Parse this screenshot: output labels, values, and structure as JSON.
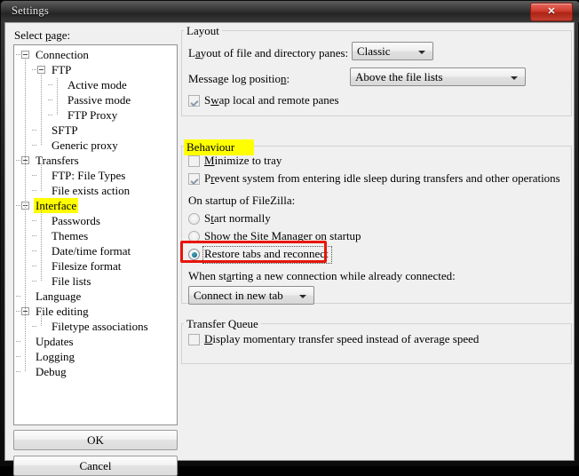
{
  "window": {
    "title": "Settings",
    "close_label": "✕"
  },
  "sidebar": {
    "label": "Select page:",
    "tree": [
      {
        "label": "Connection",
        "depth": 0,
        "expander": true,
        "highlight": false
      },
      {
        "label": "FTP",
        "depth": 1,
        "expander": true,
        "highlight": false
      },
      {
        "label": "Active mode",
        "depth": 2,
        "expander": false,
        "highlight": false
      },
      {
        "label": "Passive mode",
        "depth": 2,
        "expander": false,
        "highlight": false
      },
      {
        "label": "FTP Proxy",
        "depth": 2,
        "expander": false,
        "highlight": false
      },
      {
        "label": "SFTP",
        "depth": 1,
        "expander": false,
        "highlight": false
      },
      {
        "label": "Generic proxy",
        "depth": 1,
        "expander": false,
        "highlight": false
      },
      {
        "label": "Transfers",
        "depth": 0,
        "expander": true,
        "highlight": false
      },
      {
        "label": "FTP: File Types",
        "depth": 1,
        "expander": false,
        "highlight": false
      },
      {
        "label": "File exists action",
        "depth": 1,
        "expander": false,
        "highlight": false
      },
      {
        "label": "Interface",
        "depth": 0,
        "expander": true,
        "highlight": true
      },
      {
        "label": "Passwords",
        "depth": 1,
        "expander": false,
        "highlight": false
      },
      {
        "label": "Themes",
        "depth": 1,
        "expander": false,
        "highlight": false
      },
      {
        "label": "Date/time format",
        "depth": 1,
        "expander": false,
        "highlight": false
      },
      {
        "label": "Filesize format",
        "depth": 1,
        "expander": false,
        "highlight": false
      },
      {
        "label": "File lists",
        "depth": 1,
        "expander": false,
        "highlight": false
      },
      {
        "label": "Language",
        "depth": 0,
        "expander": false,
        "highlight": false
      },
      {
        "label": "File editing",
        "depth": 0,
        "expander": true,
        "highlight": false
      },
      {
        "label": "Filetype associations",
        "depth": 1,
        "expander": false,
        "highlight": false
      },
      {
        "label": "Updates",
        "depth": 0,
        "expander": false,
        "highlight": false
      },
      {
        "label": "Logging",
        "depth": 0,
        "expander": false,
        "highlight": false
      },
      {
        "label": "Debug",
        "depth": 0,
        "expander": false,
        "highlight": false
      }
    ],
    "ok_label": "OK",
    "cancel_label": "Cancel"
  },
  "layout_group": {
    "title": "Layout",
    "panes_label_pre": "L",
    "panes_label_key": "a",
    "panes_label_post": "yout of file and directory panes:",
    "panes_value": "Classic",
    "msglog_label_pre": "Message log positio",
    "msglog_label_key": "n",
    "msglog_label_post": ":",
    "msglog_value": "Above the file lists",
    "swap_pre": "S",
    "swap_key": "w",
    "swap_post": "ap local and remote panes",
    "swap_checked": true
  },
  "behaviour_group": {
    "title": "Behaviour",
    "minimize_pre": "",
    "minimize_key": "M",
    "minimize_post": "inimize to tray",
    "minimize_checked": false,
    "prevent_pre": "P",
    "prevent_key": "r",
    "prevent_post": "event system from entering idle sleep during transfers and other operations",
    "prevent_checked": true,
    "startup_label": "On startup of FileZilla:",
    "radios": [
      {
        "pre": "S",
        "key": "t",
        "post": "art normally",
        "selected": false
      },
      {
        "pre": "S",
        "key": "h",
        "post": "ow the Site Manager on startup",
        "selected": false
      },
      {
        "pre": "Restore tabs and reconnect",
        "key": "",
        "post": "",
        "selected": true
      }
    ],
    "newconn_label_pre": "When st",
    "newconn_label_key": "a",
    "newconn_label_post": "rting a new connection while already connected:",
    "newconn_value": "Connect in new tab"
  },
  "transfer_group": {
    "title": "Transfer Queue",
    "display_pre": "",
    "display_key": "D",
    "display_post": "isplay momentary transfer speed instead of average speed",
    "display_checked": false
  },
  "annotations": {
    "highlight_color": "#ffff00",
    "redbox_color": "#e8150a"
  }
}
